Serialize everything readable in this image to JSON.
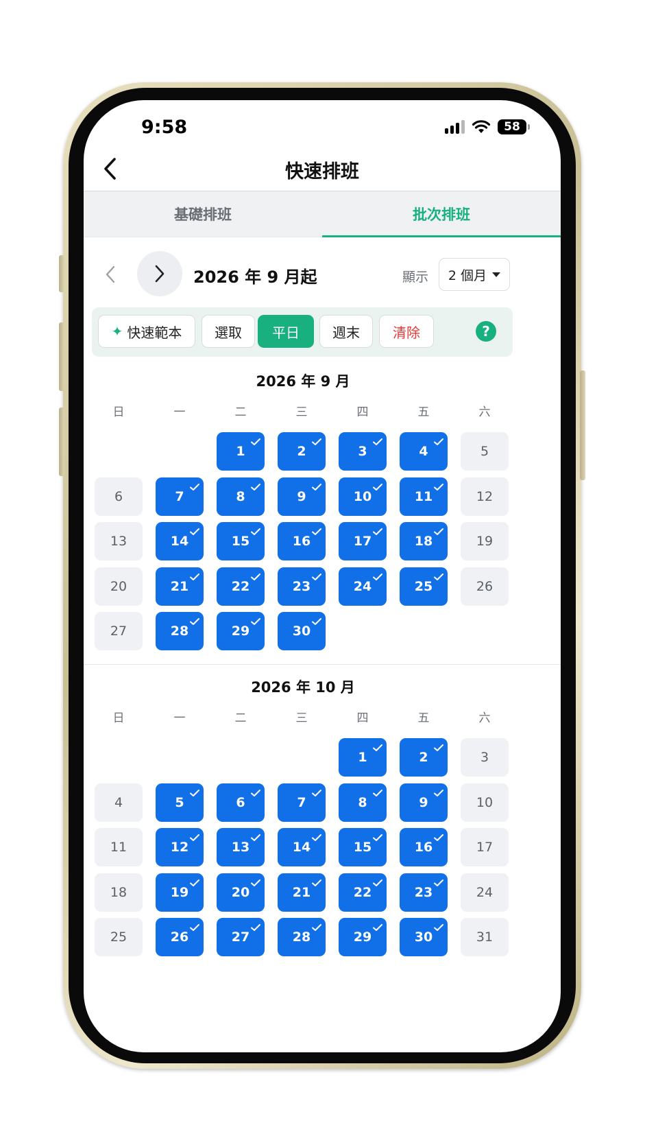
{
  "status": {
    "time": "9:58",
    "battery": "58"
  },
  "nav": {
    "title": "快速排班"
  },
  "tabs": [
    {
      "label": "基礎排班",
      "active": false
    },
    {
      "label": "批次排班",
      "active": true
    }
  ],
  "range": {
    "title": "2026 年 9 月起",
    "show_label": "顯示",
    "months_value": "2 個月"
  },
  "toolbar": {
    "template": "快速範本",
    "select": "選取",
    "weekday": "平日",
    "weekend": "週末",
    "clear": "清除",
    "help": "?"
  },
  "weekdays": [
    "日",
    "一",
    "二",
    "三",
    "四",
    "五",
    "六"
  ],
  "colors": {
    "accent": "#19b07f",
    "selected": "#1170e8",
    "danger": "#e53935"
  },
  "months": [
    {
      "title": "2026 年 9 月",
      "first_weekday": 2,
      "days": 30,
      "selected": [
        1,
        2,
        3,
        4,
        7,
        8,
        9,
        10,
        11,
        14,
        15,
        16,
        17,
        18,
        21,
        22,
        23,
        24,
        25,
        28,
        29,
        30
      ]
    },
    {
      "title": "2026 年 10 月",
      "first_weekday": 4,
      "days": 31,
      "selected": [
        1,
        2,
        5,
        6,
        7,
        8,
        9,
        12,
        13,
        14,
        15,
        16,
        19,
        20,
        21,
        22,
        23,
        26,
        27,
        28,
        29,
        30
      ]
    }
  ]
}
